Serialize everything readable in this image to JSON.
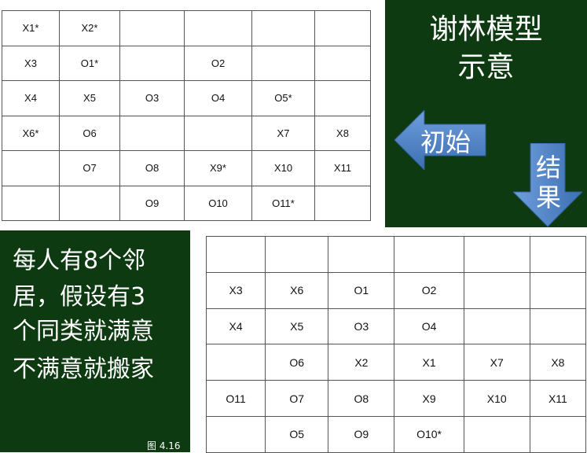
{
  "initial_grid": [
    [
      "X1*",
      "X2*",
      "",
      "",
      "",
      ""
    ],
    [
      "X3",
      "O1*",
      "",
      "O2",
      "",
      ""
    ],
    [
      "X4",
      "X5",
      "O3",
      "O4",
      "O5*",
      ""
    ],
    [
      "X6*",
      "O6",
      "",
      "",
      "X7",
      "X8"
    ],
    [
      "",
      "O7",
      "O8",
      "X9*",
      "X10",
      "X11"
    ],
    [
      "",
      "",
      "O9",
      "O10",
      "O11*",
      ""
    ]
  ],
  "result_grid": [
    [
      "",
      "",
      "",
      "",
      "",
      ""
    ],
    [
      "X3",
      "X6",
      "O1",
      "O2",
      "",
      ""
    ],
    [
      "X4",
      "X5",
      "O3",
      "O4",
      "",
      ""
    ],
    [
      "",
      "O6",
      "X2",
      "X1",
      "X7",
      "X8"
    ],
    [
      "O11",
      "O7",
      "O8",
      "X9",
      "X10",
      "X11"
    ],
    [
      "",
      "O5",
      "O9",
      "O10*",
      "",
      ""
    ]
  ],
  "title_panel": {
    "title_line1": "谢林模型",
    "title_line2": "示意",
    "initial_arrow_label": "初始",
    "result_arrow_label_line1": "结",
    "result_arrow_label_line2": "果",
    "background_color": "#0d3a10",
    "arrow_color": "#4a7fc1"
  },
  "description_panel": {
    "line1": "每人有8个邻",
    "line2": "居，假设有3",
    "line3": "个同类就满意",
    "line4": "不满意就搬家",
    "figure_label": "图 4.16"
  }
}
